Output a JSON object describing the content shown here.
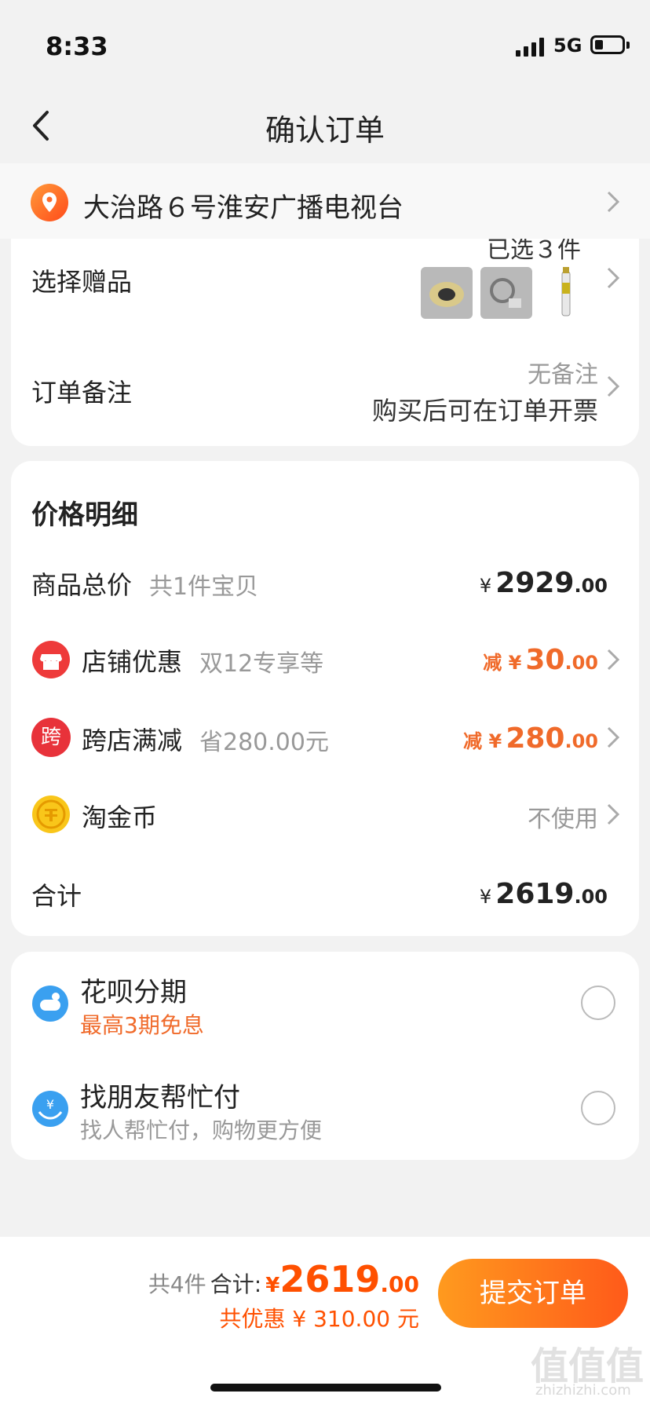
{
  "status_bar": {
    "time": "8:33",
    "network": "5G"
  },
  "nav": {
    "title": "确认订单"
  },
  "address": {
    "text": "大治路６号淮安广播电视台"
  },
  "gift": {
    "label": "选择赠品",
    "count_text": "已选３件"
  },
  "remark": {
    "label": "订单备注",
    "value": "无备注",
    "invoice_note": "购买后可在订单开票"
  },
  "price_detail": {
    "title": "价格明细",
    "goods_total": {
      "label": "商品总价",
      "sub": "共1件宝贝",
      "yen": "¥",
      "int": "2929",
      "dec": ".00"
    },
    "shop_discount": {
      "label": "店铺优惠",
      "sub": "双12专享等",
      "prefix": "减 ¥",
      "int": "30",
      "dec": ".00"
    },
    "cross_shop": {
      "icon_char": "跨",
      "label": "跨店满减",
      "sub": "省280.00元",
      "prefix": "减 ¥",
      "int": "280",
      "dec": ".00"
    },
    "gold_coin": {
      "label": "淘金币",
      "value": "不使用"
    },
    "total": {
      "label": "合计",
      "yen": "¥",
      "int": "2619",
      "dec": ".00"
    }
  },
  "payment": {
    "huabei": {
      "title": "花呗分期",
      "sub": "最高3期免息"
    },
    "friend_pay": {
      "title": "找朋友帮忙付",
      "sub": "找人帮忙付，购物更方便"
    }
  },
  "bottom": {
    "count": "共4件",
    "total_label": "合计:",
    "yen": "¥",
    "int": "2619",
    "dec": ".00",
    "saved": "共优惠 ¥ 310.00 元",
    "submit": "提交订单"
  },
  "watermark": {
    "main": "值值值",
    "sub": "zhizhizhi.com"
  },
  "colors": {
    "accent": "#ff5000",
    "button_start": "#ff9a1e",
    "button_end": "#ff5a1a",
    "background": "#f2f2f2"
  },
  "icons": [
    "back-icon",
    "location-pin-icon",
    "chevron-right-icon",
    "shop-icon",
    "cross-shop-icon",
    "coin-icon",
    "huabei-icon",
    "friend-pay-icon",
    "radio-icon"
  ]
}
